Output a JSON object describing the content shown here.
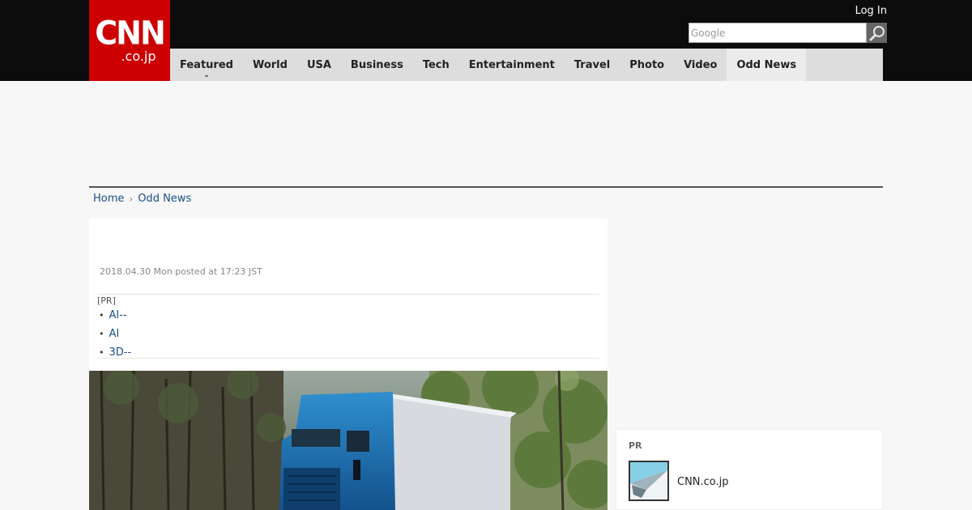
{
  "header": {
    "logo_main": "CNN",
    "logo_sub": ".co.jp",
    "login_label": "Log In",
    "search_placeholder": "Google"
  },
  "nav": {
    "items": [
      {
        "label": "Featured"
      },
      {
        "label": "World"
      },
      {
        "label": "USA"
      },
      {
        "label": "Business"
      },
      {
        "label": "Tech"
      },
      {
        "label": "Entertainment"
      },
      {
        "label": "Travel"
      },
      {
        "label": "Photo"
      },
      {
        "label": "Video"
      },
      {
        "label": "Odd News"
      }
    ],
    "active": "Odd News"
  },
  "breadcrumb": {
    "home": "Home",
    "current": "Odd News"
  },
  "article": {
    "date": "2018.04.30 Mon posted at 17:23 JST",
    "pr_label": "[PR]",
    "pr_links": [
      "AI--",
      "AI",
      "3D--"
    ]
  },
  "sidebar": {
    "pr_label": "PR",
    "item_title": "CNN.co.jp"
  },
  "colors": {
    "brand_red": "#cc0000",
    "header_bg": "#0c0c0c",
    "nav_bg": "#dddddd",
    "link": "#1a4f8a"
  }
}
